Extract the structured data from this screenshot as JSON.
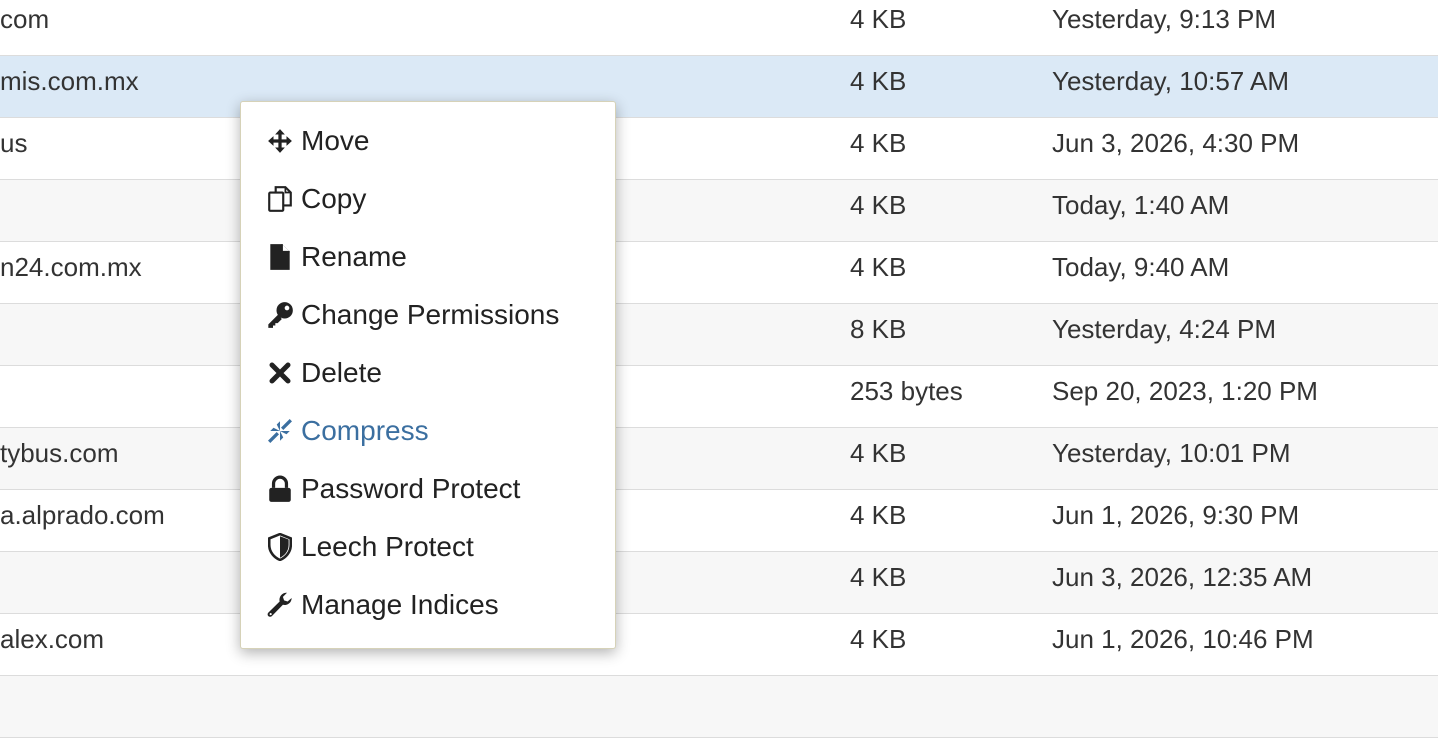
{
  "files": [
    {
      "name": "com",
      "size": "4 KB",
      "modified": "Yesterday, 9:13 PM"
    },
    {
      "name": "mis.com.mx",
      "size": "4 KB",
      "modified": "Yesterday, 10:57 AM",
      "selected": true
    },
    {
      "name": "us",
      "size": "4 KB",
      "modified": "Jun 3, 2026, 4:30 PM"
    },
    {
      "name": "",
      "size": "4 KB",
      "modified": "Today, 1:40 AM"
    },
    {
      "name": "n24.com.mx",
      "size": "4 KB",
      "modified": "Today, 9:40 AM"
    },
    {
      "name": "",
      "size": "8 KB",
      "modified": "Yesterday, 4:24 PM"
    },
    {
      "name": "",
      "size": "253 bytes",
      "modified": "Sep 20, 2023, 1:20 PM"
    },
    {
      "name": "tybus.com",
      "size": "4 KB",
      "modified": "Yesterday, 10:01 PM"
    },
    {
      "name": "a.alprado.com",
      "size": "4 KB",
      "modified": "Jun 1, 2026, 9:30 PM"
    },
    {
      "name": "",
      "size": "4 KB",
      "modified": "Jun 3, 2026, 12:35 AM"
    },
    {
      "name": "alex.com",
      "size": "4 KB",
      "modified": "Jun 1, 2026, 10:46 PM"
    }
  ],
  "context_menu": {
    "items": [
      {
        "label": "Move",
        "icon": "move-icon"
      },
      {
        "label": "Copy",
        "icon": "copy-icon"
      },
      {
        "label": "Rename",
        "icon": "file-icon"
      },
      {
        "label": "Change Permissions",
        "icon": "key-icon"
      },
      {
        "label": "Delete",
        "icon": "close-icon"
      },
      {
        "label": "Compress",
        "icon": "compress-icon",
        "highlighted": true
      },
      {
        "label": "Password Protect",
        "icon": "lock-icon"
      },
      {
        "label": "Leech Protect",
        "icon": "shield-icon"
      },
      {
        "label": "Manage Indices",
        "icon": "wrench-icon"
      }
    ]
  },
  "colors": {
    "selected_row": "#dbe9f6",
    "highlight_text": "#3b6fa0"
  }
}
